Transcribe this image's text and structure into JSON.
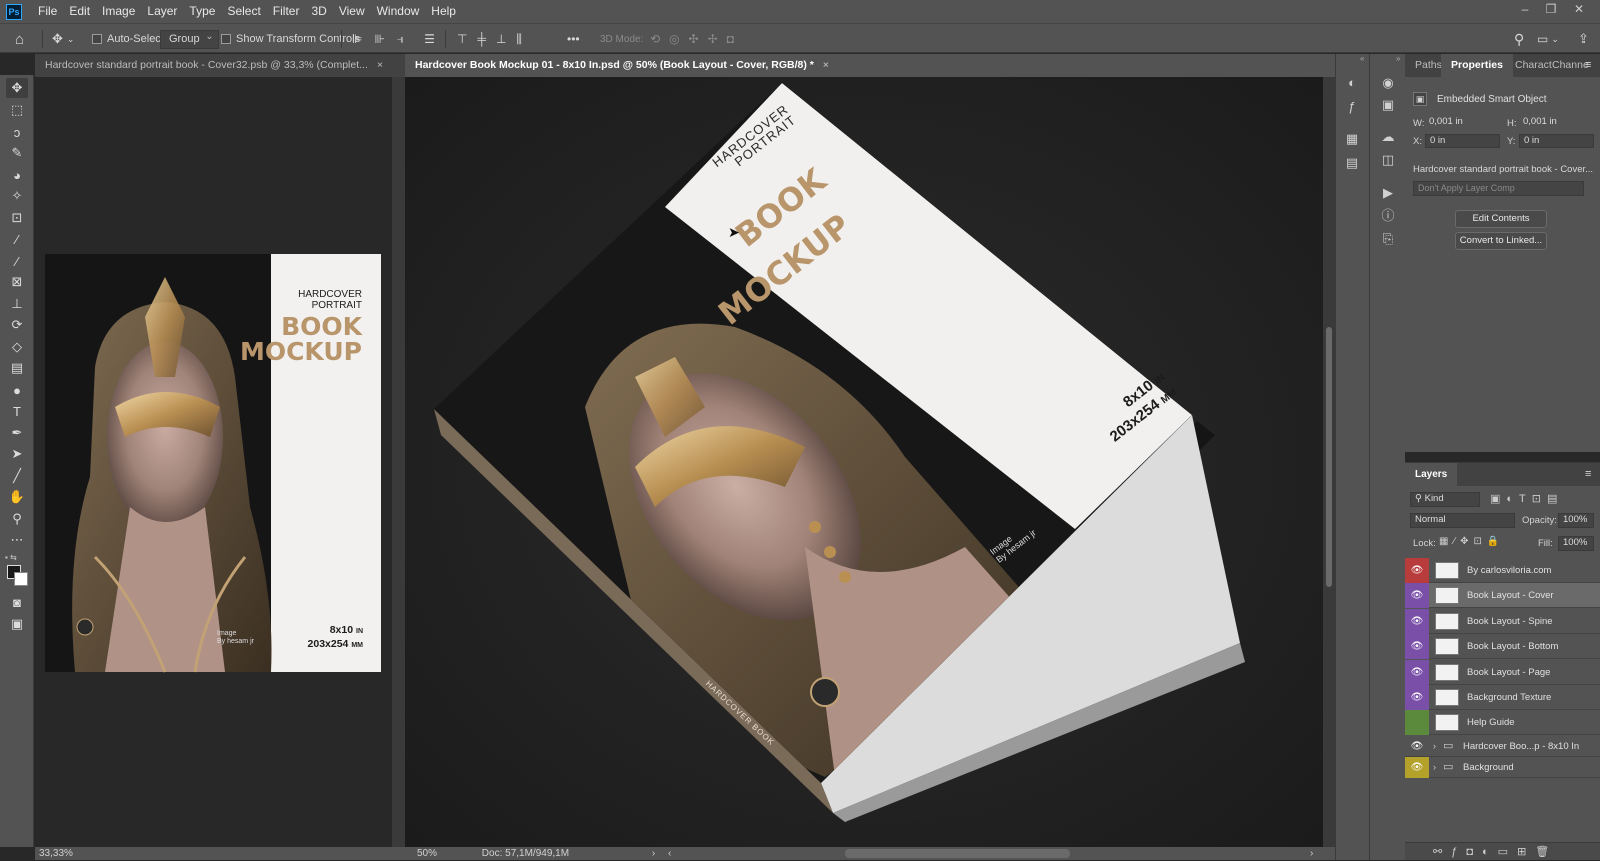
{
  "menubar": {
    "items": [
      "File",
      "Edit",
      "Image",
      "Layer",
      "Type",
      "Select",
      "Filter",
      "3D",
      "View",
      "Window",
      "Help"
    ],
    "logo": "Ps"
  },
  "options": {
    "auto_select_label": "Auto-Select:",
    "group_value": "Group",
    "show_transform_label": "Show Transform Controls",
    "mode_3d_label": "3D Mode:",
    "more": "•••"
  },
  "docs": {
    "left_tab": "Hardcover standard portrait book - Cover32.psb @ 33,3% (Complet...",
    "right_tab": "Hardcover Book Mockup 01 - 8x10 In.psd @ 50% (Book Layout - Cover, RGB/8) *",
    "close": "×"
  },
  "cover": {
    "hardcover": "HARDCOVER",
    "portrait": "PORTRAIT",
    "book": "BOOK",
    "mockup": "MOCKUP",
    "size_in": "8x10",
    "in_unit": "IN",
    "size_mm": "203x254",
    "mm_unit": "MM",
    "credit_1": "Image",
    "credit_2": "By hesam jr",
    "spine": "HARDCOVER BOOK"
  },
  "status": {
    "left_zoom": "33,33%",
    "right_zoom": "50%",
    "doc_info": "Doc: 57,1M/949,1M"
  },
  "properties": {
    "tabs": [
      "Paths",
      "Properties",
      "Charact",
      "Channe"
    ],
    "active_tab": "Properties",
    "type_label": "Embedded Smart Object",
    "w_label": "W:",
    "w_value": "0,001 in",
    "h_label": "H:",
    "h_value": "0,001 in",
    "x_label": "X:",
    "x_value": "0 in",
    "y_label": "Y:",
    "y_value": "0 in",
    "source_name": "Hardcover standard portrait book - Cover...",
    "layer_comp": "Don't Apply Layer Comp",
    "edit_contents": "Edit Contents",
    "convert_linked": "Convert to Linked..."
  },
  "layers": {
    "title": "Layers",
    "filter_kind": "Kind",
    "blend_mode": "Normal",
    "opacity_label": "Opacity:",
    "opacity_value": "100%",
    "lock_label": "Lock:",
    "fill_label": "Fill:",
    "fill_value": "100%",
    "items": [
      {
        "name": "By carlosviloria.com",
        "color": "#b83c3c",
        "visible": true,
        "group": false
      },
      {
        "name": "Book Layout - Cover",
        "color": "#7a4fa8",
        "visible": true,
        "group": false,
        "selected": true
      },
      {
        "name": "Book Layout - Spine",
        "color": "#7a4fa8",
        "visible": true,
        "group": false
      },
      {
        "name": "Book Layout - Bottom",
        "color": "#7a4fa8",
        "visible": true,
        "group": false
      },
      {
        "name": "Book Layout - Page",
        "color": "#7a4fa8",
        "visible": true,
        "group": false
      },
      {
        "name": "Background Texture",
        "color": "#7a4fa8",
        "visible": true,
        "group": false
      },
      {
        "name": "Help Guide",
        "color": "#5b8a3c",
        "visible": false,
        "group": false
      },
      {
        "name": "Hardcover Boo...p - 8x10 In",
        "color": "",
        "visible": true,
        "group": true
      },
      {
        "name": "Background",
        "color": "#b3a12a",
        "visible": true,
        "group": true
      }
    ]
  },
  "colors": {
    "panel": "#535353",
    "canvas": "#282828",
    "gold": "#b8956a",
    "accent": "#31a8ff"
  }
}
